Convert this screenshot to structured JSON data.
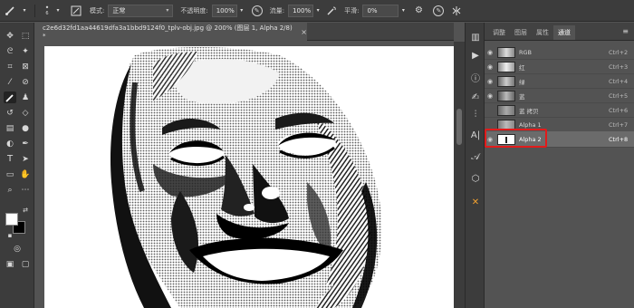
{
  "options_bar": {
    "mode_label": "模式:",
    "mode_value": "正常",
    "opacity_label": "不透明度:",
    "opacity_value": "100%",
    "flow_label": "流量:",
    "flow_value": "100%",
    "smoothing_label": "平滑:",
    "smoothing_value": "0%",
    "brush_size": "6"
  },
  "document_tab": {
    "title": "c2e6d32fd1aa44619dfa3a1bbd9124f0_tplv-obj.jpg @ 200% (图层 1, Alpha 2/8) *",
    "close": "×"
  },
  "panel": {
    "tabs": [
      "调整",
      "图层",
      "属性",
      "通道"
    ],
    "active_tab": "通道",
    "menu_icon": "≡"
  },
  "channels": [
    {
      "name": "RGB",
      "shortcut": "Ctrl+2",
      "visible": true
    },
    {
      "name": "红",
      "shortcut": "Ctrl+3",
      "visible": true
    },
    {
      "name": "绿",
      "shortcut": "Ctrl+4",
      "visible": true
    },
    {
      "name": "蓝",
      "shortcut": "Ctrl+5",
      "visible": true
    },
    {
      "name": "蓝 拷贝",
      "shortcut": "Ctrl+6",
      "visible": false
    },
    {
      "name": "Alpha 1",
      "shortcut": "Ctrl+7",
      "visible": false
    },
    {
      "name": "Alpha 2",
      "shortcut": "Ctrl+8",
      "visible": true,
      "selected": true
    }
  ],
  "colors": {
    "highlight": "#e21b1b",
    "foreground": "#ffffff",
    "background": "#000000",
    "ui_dark": "#3c3c3c",
    "ui_mid": "#535353"
  }
}
